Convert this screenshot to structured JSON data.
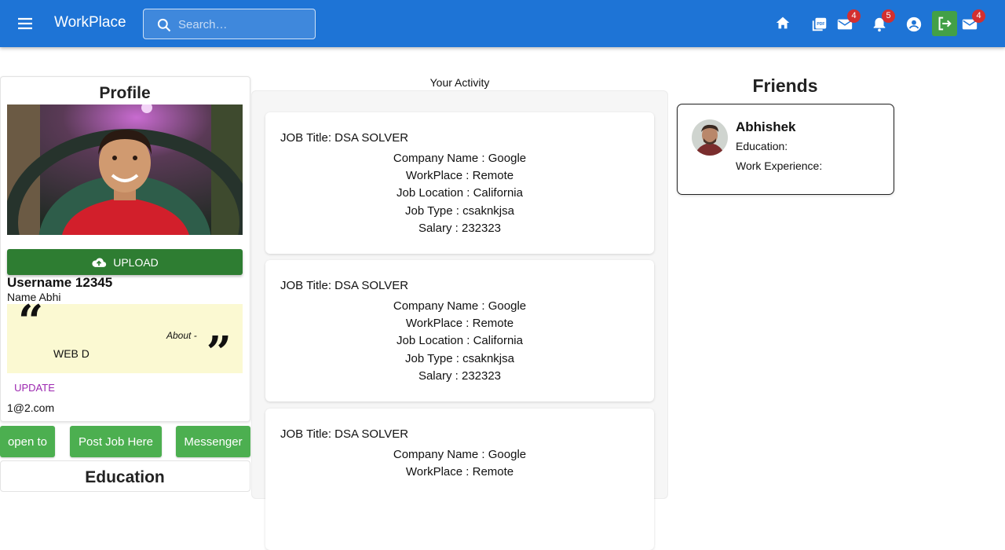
{
  "header": {
    "brand": "WorkPlace",
    "search_placeholder": "Search…",
    "badges": {
      "mail": "4",
      "notifications": "5",
      "messages": "4"
    },
    "icons": [
      "menu-icon",
      "search-icon",
      "home-icon",
      "pdf-icon",
      "mail-icon",
      "bell-icon",
      "account-circle-icon",
      "logout-icon",
      "mail-icon"
    ]
  },
  "profile": {
    "title": "Profile",
    "upload_label": "UPLOAD",
    "username": "Username 12345",
    "name": "Name Abhi",
    "about_label": "About -",
    "about_text": "WEB D",
    "update_label": "UPDATE",
    "email": "1@2.com",
    "buttons": {
      "open_to": "open to",
      "post_job": "Post Job Here",
      "messenger": "Messenger"
    },
    "education_title": "Education"
  },
  "activity": {
    "title": "Your Activity",
    "jobs": [
      {
        "title": "JOB Title: DSA SOLVER",
        "company": "Company Name : Google",
        "workplace": "WorkPlace : Remote",
        "location": "Job Location : California",
        "type": "Job Type : csaknkjsa",
        "salary": "Salary : 232323"
      },
      {
        "title": "JOB Title: DSA SOLVER",
        "company": "Company Name : Google",
        "workplace": "WorkPlace : Remote",
        "location": "Job Location : California",
        "type": "Job Type : csaknkjsa",
        "salary": "Salary : 232323"
      },
      {
        "title": "JOB Title: DSA SOLVER",
        "company": "Company Name : Google",
        "workplace": "WorkPlace : Remote"
      }
    ]
  },
  "friends": {
    "title": "Friends",
    "items": [
      {
        "name": "Abhishek",
        "education": "Education:",
        "work": "Work Experience:"
      }
    ]
  },
  "colors": {
    "appbar": "#1e74d6",
    "upload": "#2e7d32",
    "green_button": "#4caf50",
    "badge": "#d32f2f",
    "update": "#9c27b0",
    "about_bg": "#fbf9d2"
  }
}
